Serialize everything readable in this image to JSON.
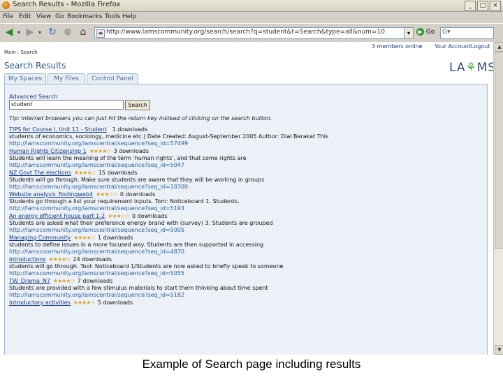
{
  "window": {
    "title": "Search Results - Mozilla Firefox"
  },
  "menu": [
    "File",
    "Edit",
    "View",
    "Go",
    "Bookmarks",
    "Tools",
    "Help"
  ],
  "address": {
    "url": "http://www.lamscommunity.org/search/search?q=student&t=Search&type=all&num=10",
    "go_label": "Go"
  },
  "site": {
    "top_links": {
      "members_online": "3 members online",
      "your_account": "Your Account",
      "logout": "Logout"
    },
    "breadcrumb": "Main : Search",
    "page_title": "Search Results",
    "logo": {
      "part1": "LA",
      "part2": "MS"
    },
    "tabs": [
      "My Spaces",
      "My Files",
      "Control Panel"
    ]
  },
  "search": {
    "advanced_label": "Advanced Search",
    "query": "student",
    "button": "Search",
    "tip": "Tip: Internet browsers you can just hit the return key instead of clicking on the search button."
  },
  "results": [
    {
      "title": "TIPS for Course I, Unit 11 - Student",
      "rating": "",
      "downloads": "1 downloads",
      "desc": "students of economics, sociology, medicine etc.) Date Created: August-September 2005 Author: Dial Barakat This",
      "url": "http://lamscommunity.org/lamscentral/sequence?seq_id=57499"
    },
    {
      "title": "Human Rights Citizenship 1",
      "rating": "★★★★☆",
      "downloads": "3 downloads",
      "desc": "Students will learn the meaning of the term 'human rights', and that some rights are",
      "url": "http://lamscommunity.org/lamscentral/sequence?seq_id=5047"
    },
    {
      "title": "NZ Govt The elections",
      "rating": "★★★★☆",
      "downloads": "15 downloads",
      "desc": "Students will go through. Make sure students are aware that they will be working in groups",
      "url": "http://lamscommunity.org/lamscentral/sequence?seq_id=10300"
    },
    {
      "title": "Website analysis_findingweb4",
      "rating": "★★★☆☆",
      "downloads": "0 downloads",
      "desc": "Students go through a list your requirement inputs. Tom: Noticeboard 1. Students.",
      "url": "http://lamscommunity.org/lamscentral/sequence?seq_id=5193"
    },
    {
      "title": "An energy efficient house part 1-2",
      "rating": "★★★☆☆",
      "downloads": "0 downloads",
      "desc": "Students are asked what their preference energy brand with (survey) 3. Students are grouped",
      "url": "http://lamscommunity.org/lamscentral/sequence?seq_id=5005"
    },
    {
      "title": "Managing Community",
      "rating": "★★★★☆",
      "downloads": "1 downloads",
      "desc": "students to define issues in a more focused way. Students are then supported in accessing",
      "url": "http://lamscommunity.org/lamscentral/sequence?seq_id=4870"
    },
    {
      "title": "Introductions",
      "rating": "★★★★☆",
      "downloads": "24 downloads",
      "desc": "students will go through. Tool: Noticeboard 1/Students are now asked to briefly speak to someone",
      "url": "http://lamscommunity.org/lamscentral/sequence?seq_id=5055"
    },
    {
      "title": "TW_Drama_N7",
      "rating": "★★★★☆",
      "downloads": "7 downloads",
      "desc": "Students are provided with a few stimulus materials to start them thinking about time spent",
      "url": "http://lamscommunity.org/lamscentral/sequence?seq_id=5182"
    },
    {
      "title": "Introductory activities",
      "rating": "★★★★☆",
      "downloads": "5 downloads",
      "desc": "",
      "url": ""
    }
  ],
  "caption": "Example of Search page including results"
}
